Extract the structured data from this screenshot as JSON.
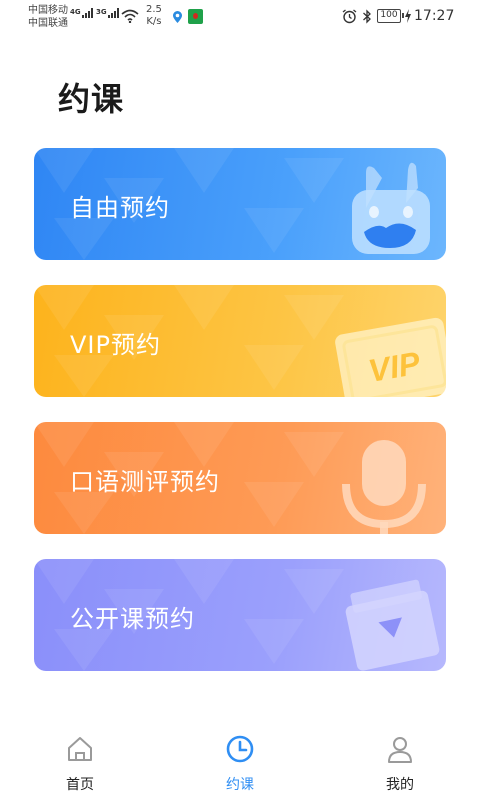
{
  "status_bar": {
    "carrier_1": "中国移动",
    "carrier_2": "中国联通",
    "net_1": "4G",
    "net_2": "3G",
    "speed_value": "2.5",
    "speed_unit": "K/s",
    "battery": "100",
    "time": "17:27",
    "icons": [
      "signal-icon",
      "wifi-icon",
      "location-icon",
      "app-notification-icon",
      "alarm-icon",
      "bluetooth-icon",
      "battery-icon",
      "charging-icon"
    ]
  },
  "page": {
    "title": "约课"
  },
  "cards": {
    "free": {
      "label": "自由预约",
      "color": "#3b93f7",
      "icon": "rabbit-mascot-icon"
    },
    "vip": {
      "label": "VIP预约",
      "color": "#fdbb30",
      "icon": "vip-card-icon",
      "icon_text": "VIP"
    },
    "oral": {
      "label": "口语测评预约",
      "color": "#fe934a",
      "icon": "microphone-icon"
    },
    "public": {
      "label": "公开课预约",
      "color": "#9296fb",
      "icon": "video-folder-icon"
    }
  },
  "bottom_nav": {
    "active": "约课",
    "accent": "#2f8ef3",
    "items": [
      {
        "label": "首页",
        "icon": "home-icon"
      },
      {
        "label": "约课",
        "icon": "clock-icon"
      },
      {
        "label": "我的",
        "icon": "user-icon"
      }
    ]
  }
}
